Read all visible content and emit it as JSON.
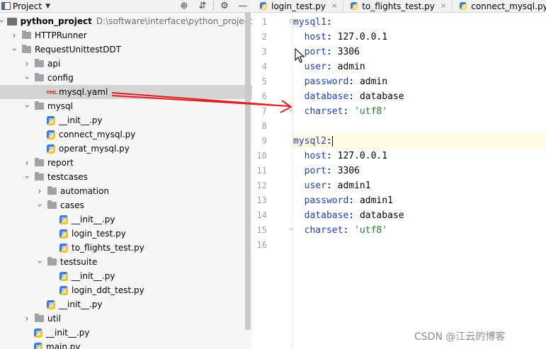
{
  "project_panel": {
    "title": "Project",
    "tree": [
      {
        "label": "python_project",
        "path": "D:\\software\\interface\\python_project",
        "type": "project",
        "depth": 0,
        "expanded": true,
        "bold": true
      },
      {
        "label": "HTTPRunner",
        "type": "folder",
        "depth": 1,
        "expanded": false
      },
      {
        "label": "RequestUnittestDDT",
        "type": "folder",
        "depth": 1,
        "expanded": true
      },
      {
        "label": "api",
        "type": "folder",
        "depth": 2,
        "expanded": false
      },
      {
        "label": "config",
        "type": "folder",
        "depth": 2,
        "expanded": true
      },
      {
        "label": "mysql.yaml",
        "type": "yaml",
        "depth": 3,
        "selected": true
      },
      {
        "label": "mysql",
        "type": "folder",
        "depth": 2,
        "expanded": true
      },
      {
        "label": "__init__.py",
        "type": "py",
        "depth": 3
      },
      {
        "label": "connect_mysql.py",
        "type": "py",
        "depth": 3
      },
      {
        "label": "operat_mysql.py",
        "type": "py",
        "depth": 3
      },
      {
        "label": "report",
        "type": "folder",
        "depth": 2,
        "expanded": false
      },
      {
        "label": "testcases",
        "type": "folder",
        "depth": 2,
        "expanded": true
      },
      {
        "label": "automation",
        "type": "folder",
        "depth": 3,
        "expanded": false
      },
      {
        "label": "cases",
        "type": "folder",
        "depth": 3,
        "expanded": true
      },
      {
        "label": "__init__.py",
        "type": "py",
        "depth": 4
      },
      {
        "label": "login_test.py",
        "type": "py",
        "depth": 4
      },
      {
        "label": "to_flights_test.py",
        "type": "py",
        "depth": 4
      },
      {
        "label": "testsuite",
        "type": "folder",
        "depth": 3,
        "expanded": true
      },
      {
        "label": "__init__.py",
        "type": "py",
        "depth": 4
      },
      {
        "label": "login_ddt_test.py",
        "type": "py",
        "depth": 4
      },
      {
        "label": "__init__.py",
        "type": "py",
        "depth": 3
      },
      {
        "label": "util",
        "type": "folder",
        "depth": 2,
        "expanded": false
      },
      {
        "label": "__init__.py",
        "type": "py",
        "depth": 2
      },
      {
        "label": "main.py",
        "type": "py",
        "depth": 2
      }
    ]
  },
  "editor": {
    "tabs": [
      {
        "label": "login_test.py"
      },
      {
        "label": "to_flights_test.py"
      },
      {
        "label": "connect_mysql.py"
      }
    ],
    "line_numbers": [
      "1",
      "2",
      "3",
      "4",
      "5",
      "6",
      "7",
      "8",
      "9",
      "10",
      "11",
      "12",
      "13",
      "14",
      "15",
      "16"
    ],
    "lines": [
      {
        "key": "mysql1",
        "indent": 0,
        "sep": ":",
        "value": "",
        "fold": "open"
      },
      {
        "key": "host",
        "indent": 1,
        "sep": ": ",
        "value": "127.0.0.1"
      },
      {
        "key": "port",
        "indent": 1,
        "sep": ": ",
        "value": "3306"
      },
      {
        "key": "user",
        "indent": 1,
        "sep": ": ",
        "value": "admin"
      },
      {
        "key": "password",
        "indent": 1,
        "sep": ": ",
        "value": "admin"
      },
      {
        "key": "database",
        "indent": 1,
        "sep": ": ",
        "value": "database"
      },
      {
        "key": "charset",
        "indent": 1,
        "sep": ": ",
        "value": "'utf8'",
        "string": true,
        "fold": "close"
      },
      {
        "key": "",
        "indent": 0,
        "sep": "",
        "value": ""
      },
      {
        "key": "mysql2",
        "indent": 0,
        "sep": ":",
        "value": "",
        "current": true,
        "caret": true
      },
      {
        "key": "host",
        "indent": 1,
        "sep": ": ",
        "value": "127.0.0.1"
      },
      {
        "key": "port",
        "indent": 1,
        "sep": ": ",
        "value": "3306"
      },
      {
        "key": "user",
        "indent": 1,
        "sep": ": ",
        "value": "admin1"
      },
      {
        "key": "password",
        "indent": 1,
        "sep": ": ",
        "value": "admin1"
      },
      {
        "key": "database",
        "indent": 1,
        "sep": ": ",
        "value": "database"
      },
      {
        "key": "charset",
        "indent": 1,
        "sep": ": ",
        "value": "'utf8'",
        "string": true,
        "fold": "close"
      },
      {
        "key": "",
        "indent": 0,
        "sep": "",
        "value": ""
      }
    ]
  },
  "annotation_color": "#e02020",
  "watermark": "CSDN @江云的博客"
}
